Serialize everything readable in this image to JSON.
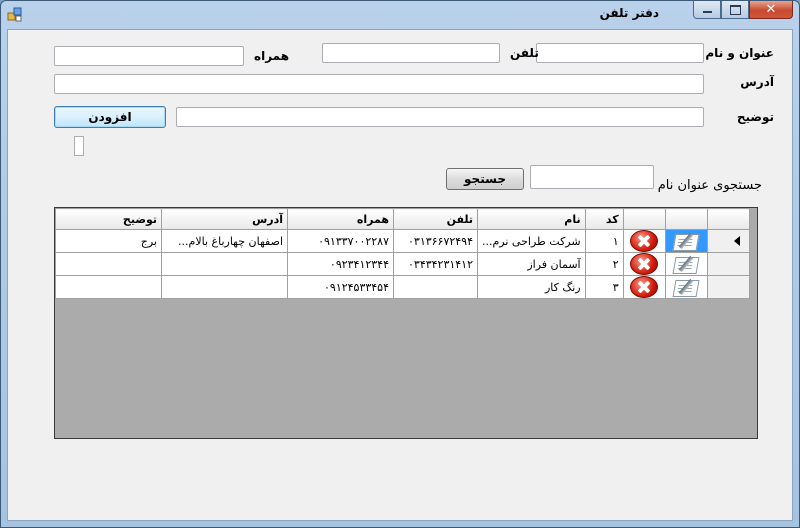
{
  "window": {
    "title": "دفتر تلفن",
    "close_glyph": "✕"
  },
  "form": {
    "name_label": "عنوان و نام",
    "phone_label": "تلفن",
    "mobile_label": "همراه",
    "address_label": "آدرس",
    "desc_label": "توضیح",
    "add_button": "افزودن",
    "search_label": "جستجوی عنوان نام",
    "search_button": "جستجو",
    "name_value": "",
    "phone_value": "",
    "mobile_value": "",
    "address_value": "",
    "desc_value": "",
    "search_value": ""
  },
  "grid": {
    "headers": [
      "کد",
      "نام",
      "تلفن",
      "همراه",
      "آدرس",
      "توضیح"
    ],
    "rows": [
      [
        "۱",
        "شرکت طراحی نرم...",
        "۰۳۱۳۶۶۷۲۴۹۴",
        "۰۹۱۳۳۷۰۰۲۲۸۷",
        "اصفهان چهارباغ بالام...",
        "برج"
      ],
      [
        "۲",
        "آسمان فراز",
        "۰۳۴۳۴۲۳۱۴۱۲",
        "۰۹۲۳۴۱۲۳۴۴",
        "",
        ""
      ],
      [
        "۳",
        "رنگ کار",
        "",
        "۰۹۱۲۴۵۳۳۴۵۴",
        "",
        ""
      ]
    ]
  },
  "colors": {
    "selected_icon_bg": "#3399ff",
    "grid_background": "#ababab"
  }
}
